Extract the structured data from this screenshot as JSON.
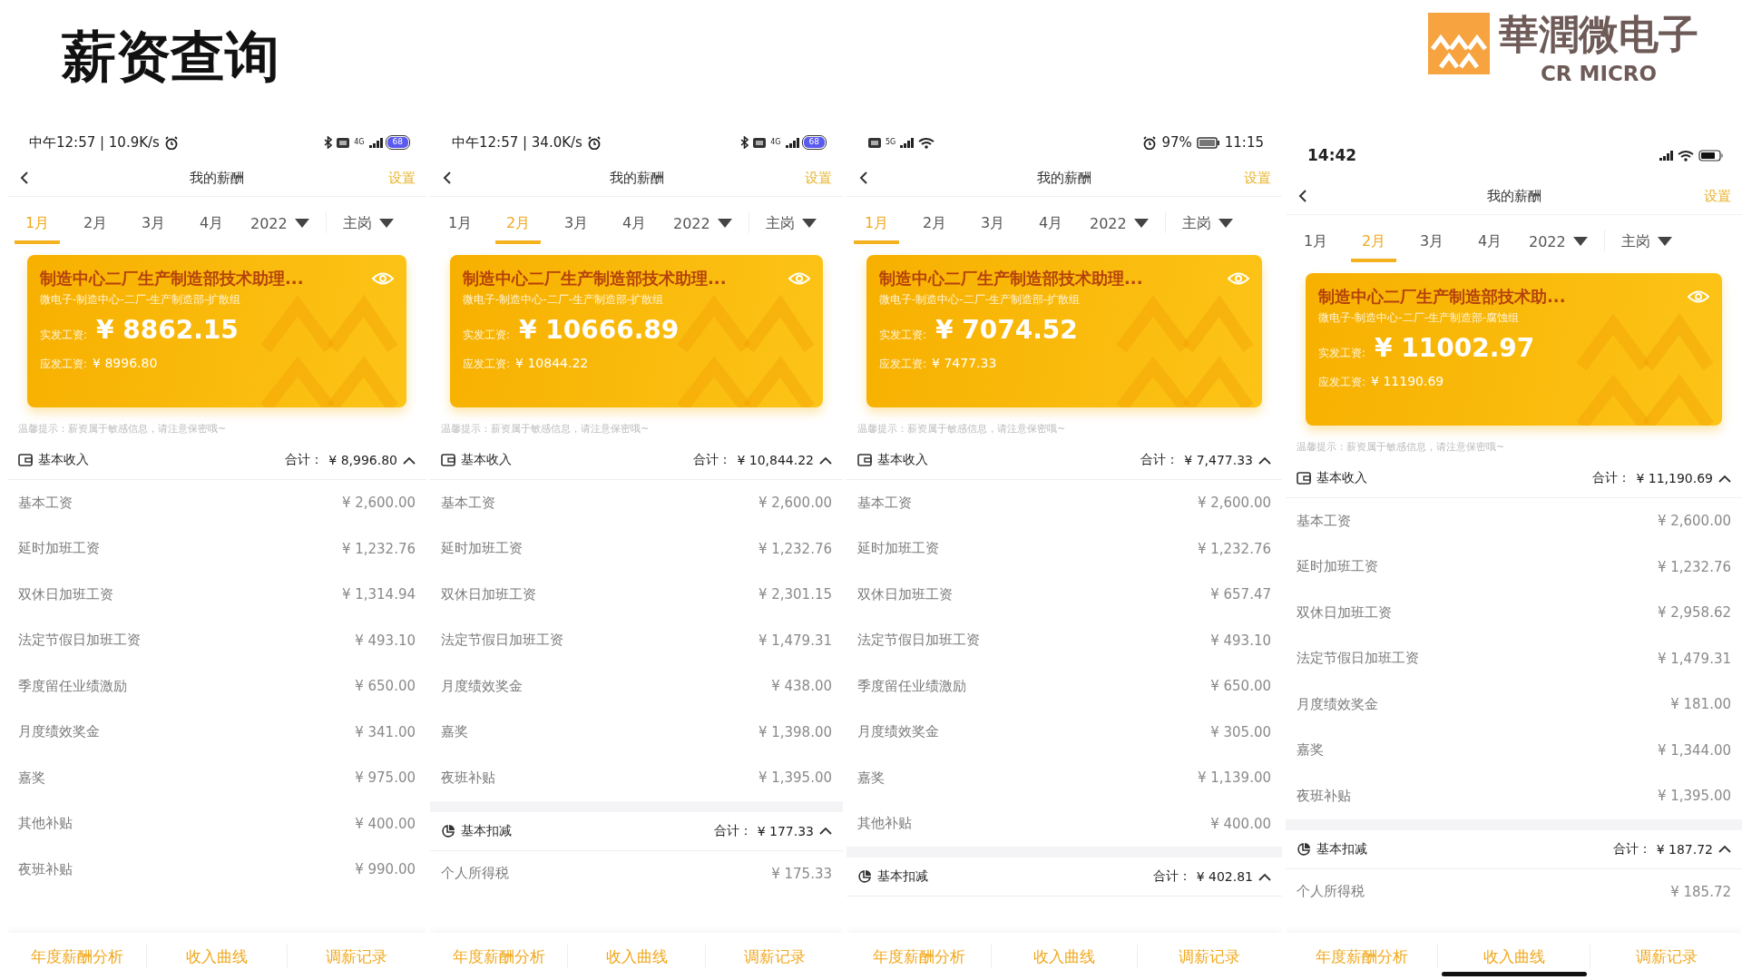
{
  "title": "薪资查询",
  "logo": {
    "name": "華潤微电子",
    "subtitle": "CR MICRO"
  },
  "phones": [
    {
      "status_bar": {
        "kind": "miui",
        "text": "中午12:57 | 10.9K/s",
        "network": "4G",
        "battery": "68"
      },
      "nav": {
        "title": "我的薪酬",
        "action": "设置"
      },
      "months": [
        {
          "label": "1月",
          "selected": true
        },
        {
          "label": "2月",
          "selected": false
        },
        {
          "label": "3月",
          "selected": false
        },
        {
          "label": "4月",
          "selected": false
        }
      ],
      "year": "2022",
      "post": "主岗",
      "card": {
        "title": "制造中心二厂生产制造部技术助理...",
        "dept": "微电子-制造中心-二厂-生产制造部-扩散组",
        "actual_label": "实发工资:",
        "actual": "¥ 8862.15",
        "due_label": "应发工资:",
        "due": "¥ 8996.80"
      },
      "tip": "温馨提示：薪资属于敏感信息，请注意保密哦~",
      "sections": [
        {
          "kind": "income",
          "title": "基本收入",
          "total_label": "合计：",
          "total": "¥ 8,996.80",
          "expanded": true,
          "rows": [
            {
              "label": "基本工资",
              "value": "¥ 2,600.00"
            },
            {
              "label": "延时加班工资",
              "value": "¥ 1,232.76"
            },
            {
              "label": "双休日加班工资",
              "value": "¥ 1,314.94"
            },
            {
              "label": "法定节假日加班工资",
              "value": "¥ 493.10"
            },
            {
              "label": "季度留任业绩激励",
              "value": "¥ 650.00"
            },
            {
              "label": "月度绩效奖金",
              "value": "¥ 341.00"
            },
            {
              "label": "嘉奖",
              "value": "¥ 975.00"
            },
            {
              "label": "其他补贴",
              "value": "¥ 400.00"
            },
            {
              "label": "夜班补贴",
              "value": "¥ 990.00"
            }
          ]
        }
      ],
      "bottom_tabs": [
        "年度薪酬分析",
        "收入曲线",
        "调薪记录"
      ]
    },
    {
      "status_bar": {
        "kind": "miui",
        "text": "中午12:57 | 34.0K/s",
        "network": "4G",
        "battery": "68"
      },
      "nav": {
        "title": "我的薪酬",
        "action": "设置"
      },
      "months": [
        {
          "label": "1月",
          "selected": false
        },
        {
          "label": "2月",
          "selected": true
        },
        {
          "label": "3月",
          "selected": false
        },
        {
          "label": "4月",
          "selected": false
        }
      ],
      "year": "2022",
      "post": "主岗",
      "card": {
        "title": "制造中心二厂生产制造部技术助理...",
        "dept": "微电子-制造中心-二厂-生产制造部-扩散组",
        "actual_label": "实发工资:",
        "actual": "¥ 10666.89",
        "due_label": "应发工资:",
        "due": "¥ 10844.22"
      },
      "tip": "温馨提示：薪资属于敏感信息，请注意保密哦~",
      "sections": [
        {
          "kind": "income",
          "title": "基本收入",
          "total_label": "合计：",
          "total": "¥ 10,844.22",
          "expanded": true,
          "rows": [
            {
              "label": "基本工资",
              "value": "¥ 2,600.00"
            },
            {
              "label": "延时加班工资",
              "value": "¥ 1,232.76"
            },
            {
              "label": "双休日加班工资",
              "value": "¥ 2,301.15"
            },
            {
              "label": "法定节假日加班工资",
              "value": "¥ 1,479.31"
            },
            {
              "label": "月度绩效奖金",
              "value": "¥ 438.00"
            },
            {
              "label": "嘉奖",
              "value": "¥ 1,398.00"
            },
            {
              "label": "夜班补贴",
              "value": "¥ 1,395.00"
            }
          ]
        },
        {
          "kind": "deduction",
          "title": "基本扣减",
          "total_label": "合计：",
          "total": "¥ 177.33",
          "expanded": true,
          "rows": [
            {
              "label": "个人所得税",
              "value": "¥ 175.33"
            }
          ]
        }
      ],
      "bottom_tabs": [
        "年度薪酬分析",
        "收入曲线",
        "调薪记录"
      ]
    },
    {
      "status_bar": {
        "kind": "emui",
        "network": "5G",
        "battery": "97%",
        "time": "11:15"
      },
      "nav": {
        "title": "我的薪酬",
        "action": "设置"
      },
      "months": [
        {
          "label": "1月",
          "selected": true
        },
        {
          "label": "2月",
          "selected": false
        },
        {
          "label": "3月",
          "selected": false
        },
        {
          "label": "4月",
          "selected": false
        }
      ],
      "year": "2022",
      "post": "主岗",
      "card": {
        "title": "制造中心二厂生产制造部技术助理...",
        "dept": "微电子-制造中心-二厂-生产制造部-扩散组",
        "actual_label": "实发工资:",
        "actual": "¥ 7074.52",
        "due_label": "应发工资:",
        "due": "¥ 7477.33"
      },
      "tip": "温馨提示：薪资属于敏感信息，请注意保密哦~",
      "sections": [
        {
          "kind": "income",
          "title": "基本收入",
          "total_label": "合计：",
          "total": "¥ 7,477.33",
          "expanded": true,
          "rows": [
            {
              "label": "基本工资",
              "value": "¥ 2,600.00"
            },
            {
              "label": "延时加班工资",
              "value": "¥ 1,232.76"
            },
            {
              "label": "双休日加班工资",
              "value": "¥ 657.47"
            },
            {
              "label": "法定节假日加班工资",
              "value": "¥ 493.10"
            },
            {
              "label": "季度留任业绩激励",
              "value": "¥ 650.00"
            },
            {
              "label": "月度绩效奖金",
              "value": "¥ 305.00"
            },
            {
              "label": "嘉奖",
              "value": "¥ 1,139.00"
            },
            {
              "label": "其他补贴",
              "value": "¥ 400.00"
            }
          ]
        },
        {
          "kind": "deduction",
          "title": "基本扣减",
          "total_label": "合计：",
          "total": "¥ 402.81",
          "expanded": true
        }
      ],
      "bottom_tabs": [
        "年度薪酬分析",
        "收入曲线",
        "调薪记录"
      ]
    },
    {
      "status_bar": {
        "kind": "ios",
        "time": "14:42"
      },
      "nav": {
        "title": "我的薪酬",
        "action": "设置"
      },
      "months": [
        {
          "label": "1月",
          "selected": false
        },
        {
          "label": "2月",
          "selected": true
        },
        {
          "label": "3月",
          "selected": false
        },
        {
          "label": "4月",
          "selected": false
        }
      ],
      "year": "2022",
      "post": "主岗",
      "card": {
        "title": "制造中心二厂生产制造部技术助...",
        "dept": "微电子-制造中心-二厂-生产制造部-腐蚀组",
        "actual_label": "实发工资:",
        "actual": "¥ 11002.97",
        "due_label": "应发工资:",
        "due": "¥ 11190.69"
      },
      "tip": "温馨提示：薪资属于敏感信息，请注意保密哦~",
      "sections": [
        {
          "kind": "income",
          "title": "基本收入",
          "total_label": "合计：",
          "total": "¥ 11,190.69",
          "expanded": true,
          "rows": [
            {
              "label": "基本工资",
              "value": "¥ 2,600.00"
            },
            {
              "label": "延时加班工资",
              "value": "¥ 1,232.76"
            },
            {
              "label": "双休日加班工资",
              "value": "¥ 2,958.62"
            },
            {
              "label": "法定节假日加班工资",
              "value": "¥ 1,479.31"
            },
            {
              "label": "月度绩效奖金",
              "value": "¥ 181.00"
            },
            {
              "label": "嘉奖",
              "value": "¥ 1,344.00"
            },
            {
              "label": "夜班补贴",
              "value": "¥ 1,395.00"
            }
          ]
        },
        {
          "kind": "deduction",
          "title": "基本扣减",
          "total_label": "合计：",
          "total": "¥ 187.72",
          "expanded": true,
          "rows": [
            {
              "label": "个人所得税",
              "value": "¥ 185.72"
            }
          ]
        }
      ],
      "bottom_tabs": [
        "年度薪酬分析",
        "收入曲线",
        "调薪记录"
      ]
    }
  ]
}
